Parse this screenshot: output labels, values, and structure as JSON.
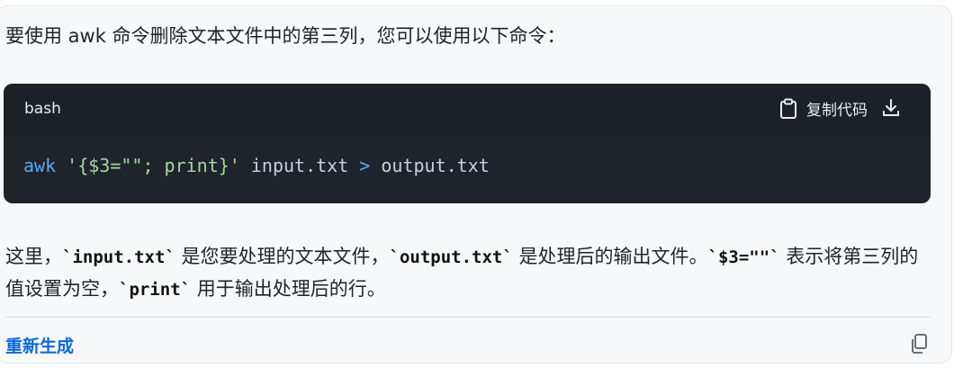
{
  "message": {
    "intro": "要使用 awk 命令删除文本文件中的第三列，您可以使用以下命令：",
    "code_block": {
      "language": "bash",
      "copy_label": "复制代码",
      "icons": {
        "copy": "clipboard-icon",
        "download": "download-icon"
      },
      "tokens": [
        {
          "text": "awk",
          "kind": "kw"
        },
        {
          "text": " ",
          "kind": "plain"
        },
        {
          "text": "'{$3=\"\"; print}'",
          "kind": "str"
        },
        {
          "text": " input.txt ",
          "kind": "plain"
        },
        {
          "text": ">",
          "kind": "op"
        },
        {
          "text": " output.txt",
          "kind": "plain"
        }
      ]
    },
    "explanation": {
      "p1": "这里，",
      "c1": "`input.txt`",
      "p2": " 是您要处理的文本文件，",
      "c2": "`output.txt`",
      "p3": " 是处理后的输出文件。",
      "c3": "`$3=\"\"`",
      "p4": " 表示将第三列的值设置为空，",
      "c4": "`print`",
      "p5": " 用于输出处理后的行。"
    },
    "actions": {
      "regenerate_label": "重新生成",
      "copy_icon": "copy-icon"
    }
  },
  "colors": {
    "code_bg": "#1f242b",
    "keyword": "#58a6ff",
    "string": "#a5d6a7",
    "link": "#0969da"
  }
}
